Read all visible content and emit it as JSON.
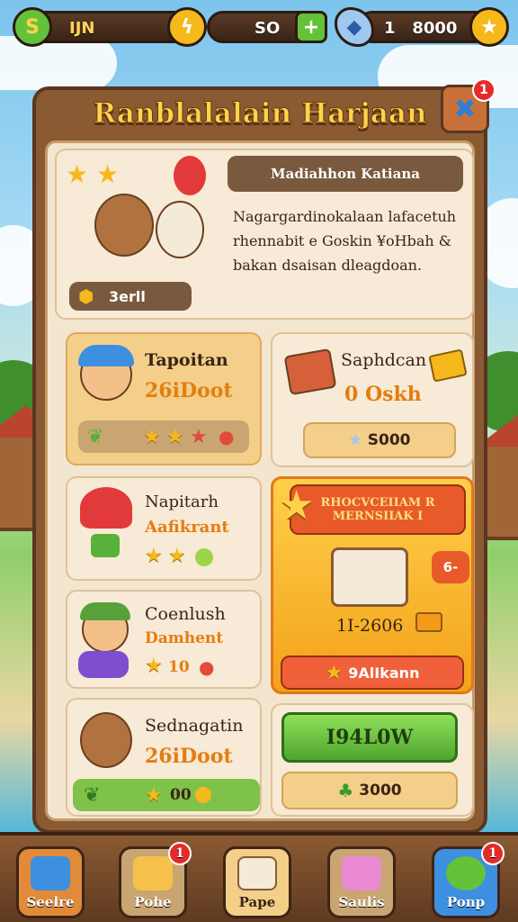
{
  "topbar": {
    "left_currency_value": "IJN",
    "middle_value": "SO",
    "right_currency_value": "1   8000",
    "add_symbol": "+"
  },
  "panel": {
    "title": "Ranblalalain Harjaan",
    "close_badge": "1"
  },
  "event": {
    "header": "Madiahhon Katiana",
    "description": "Nagargardinokalaan lafacetuh rhennabit e Goskin ¥oHbah & bakan dsaisan dleagdoan.",
    "counter": "3erll"
  },
  "tasks": [
    {
      "name": "Tapoitan",
      "reward": "26iDoot"
    },
    {
      "name": "Napitarh",
      "reward": "Aafikrant"
    },
    {
      "name": "Coenlush",
      "reward": "Damhent",
      "stars_label": "10"
    },
    {
      "name": "Sednagatin",
      "reward": "26iDoot",
      "stars_label": "00"
    }
  ],
  "shop_item": {
    "name": "Saphdcan",
    "sub": "0 Oskh",
    "price": "S000"
  },
  "featured": {
    "banner_line1": "RHOCVCEIIAM R",
    "banner_line2": "MERNSIIAK I",
    "amount": "1I-2606",
    "side_tag": "6-",
    "action": "9AlIkann"
  },
  "buy_button": "I94L0W",
  "bottom_price": "3000",
  "bottom_nav": [
    {
      "label": "Seelre"
    },
    {
      "label": "Pohe",
      "badge": "1"
    },
    {
      "label": "Pape"
    },
    {
      "label": "Saulis"
    },
    {
      "label": "Ponp",
      "badge": "1"
    }
  ]
}
